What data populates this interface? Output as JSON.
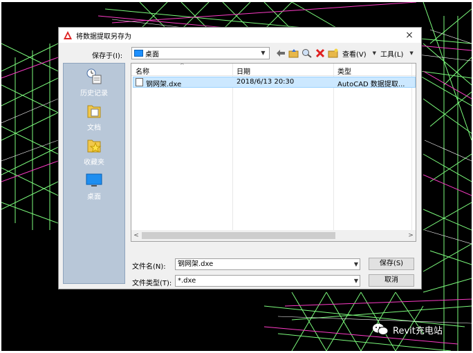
{
  "dialog": {
    "title": "将数据提取另存为",
    "close_glyph": "×",
    "save_in_label": "保存于(I):",
    "save_in_value": "桌面"
  },
  "toolbar": {
    "view_label": "查看(V)",
    "tools_label": "工具(L)"
  },
  "places": [
    {
      "label": "历史记录",
      "icon": "history-icon"
    },
    {
      "label": "文档",
      "icon": "documents-icon"
    },
    {
      "label": "收藏夹",
      "icon": "favorites-icon"
    },
    {
      "label": "桌面",
      "icon": "desktop-icon"
    }
  ],
  "filelist": {
    "columns": [
      "名称",
      "日期",
      "类型"
    ],
    "rows": [
      {
        "name": "钢网架.dxe",
        "date": "2018/6/13 20:30",
        "type": "AutoCAD 数据提取..."
      }
    ]
  },
  "fields": {
    "filename_label": "文件名(N):",
    "filename_value": "钢网架.dxe",
    "filetype_label": "文件类型(T):",
    "filetype_value": "*.dxe"
  },
  "buttons": {
    "save_label": "保存(S)",
    "cancel_label": "取消"
  },
  "watermark": {
    "text": "Revit充电站"
  }
}
